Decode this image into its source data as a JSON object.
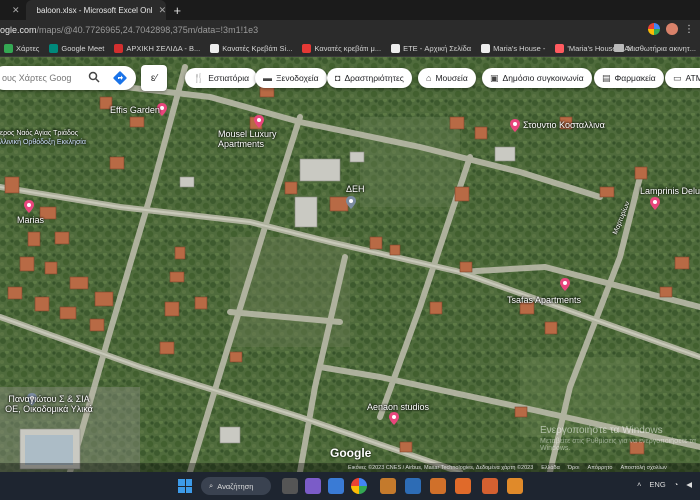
{
  "browser": {
    "tabs": [
      {
        "label": "",
        "active": false
      },
      {
        "label": "baloon.xlsx - Microsoft Excel Onl",
        "active": true
      }
    ],
    "new_tab": "+",
    "url_main": "ogle.com",
    "url_rest": "/maps/@40.7726965,24.7042898,375m/data=!3m1!1e3"
  },
  "bookmarks": {
    "items": [
      {
        "label": "Χάρτες",
        "color": "#34a853"
      },
      {
        "label": "Google Meet",
        "color": "#00897b"
      },
      {
        "label": "ΑΡΧΙΚΗ ΣΕΛΙΔΑ - Β...",
        "color": "#d32f2f"
      },
      {
        "label": "Κανατές Κρεβάτι Si...",
        "color": "#eeeeee"
      },
      {
        "label": "Κανατές κρεβάτι μ...",
        "color": "#e53935"
      },
      {
        "label": "ETE - Αρχική Σελίδα",
        "color": "#eeeeee"
      },
      {
        "label": "Maria's House -",
        "color": "#eeeeee"
      },
      {
        "label": "'Maria's House' - Ai...",
        "color": "#ff5a5f"
      }
    ],
    "folder_label": "Μισθωτήρια ακινητ..."
  },
  "search": {
    "placeholder": "ους Χάρτες Goog"
  },
  "chips": [
    {
      "label": "Εστιατόρια",
      "icon": "fork-knife-icon"
    },
    {
      "label": "Ξενοδοχεία",
      "icon": "bed-icon"
    },
    {
      "label": "Δραστηριότητες",
      "icon": "camera-icon"
    },
    {
      "label": "Μουσεία",
      "icon": "museum-icon"
    },
    {
      "label": "Δημόσιο συγκοινωνία",
      "icon": "transit-icon"
    },
    {
      "label": "Φαρμακεία",
      "icon": "pharmacy-icon"
    },
    {
      "label": "ATM",
      "icon": "atm-icon"
    }
  ],
  "places": {
    "effis": "Effis Garden",
    "mousel": "Mousel Luxury Apartments",
    "stoudio": "Στουντιο Κοσταλλινα",
    "deh": "ΔΕΗ",
    "marias": "Marias",
    "lamprinis": "Lamprinis Delu",
    "tsafas": "Tsafas Apartments",
    "panagiotou": "Παναγιώτου Σ & ΣΙΑ ΟΕ, Οικοδομικά Υλικά",
    "aenaon": "Aenaon studios",
    "church": "ερος Ναός Αγίας Τριάδος",
    "church_sub": "λλινική Ορθόδοξη Εκκλησία",
    "street": "Μαρτυρίων"
  },
  "map_footer": {
    "logo": "Google",
    "attribution": "Εικόνες ©2023 CNES / Airbus, Maxar Technologies, Δεδομένα χάρτη ©2023",
    "links": [
      "Ελλάδα",
      "Όροι",
      "Απόρρητο",
      "Αποστολή σχολίων"
    ],
    "watermark_title": "Ενεργοποιήστε τα Windows",
    "watermark_sub": "Μεταβείτε στις Ρυθμίσεις για να ενεργοποιήσετε τα Windows."
  },
  "taskbar": {
    "search_label": "Αναζήτηση",
    "lang": "ENG"
  }
}
